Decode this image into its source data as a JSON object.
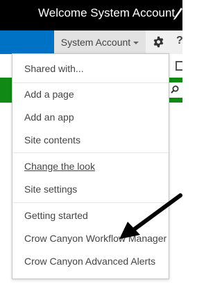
{
  "header": {
    "welcome_text": "Welcome System Account"
  },
  "suite_bar": {
    "account_label": "System Account"
  },
  "menu": {
    "items": [
      {
        "label": "Shared with..."
      },
      {
        "label": "Add a page"
      },
      {
        "label": "Add an app"
      },
      {
        "label": "Site contents"
      },
      {
        "label": "Change the look"
      },
      {
        "label": "Site settings"
      },
      {
        "label": "Getting started"
      },
      {
        "label": "Crow Canyon Workflow Manager"
      },
      {
        "label": "Crow Canyon Advanced Alerts"
      }
    ]
  },
  "icons": {
    "edit": "pencil-icon",
    "settings": "gear-icon",
    "help": "help-icon",
    "search": "search-icon",
    "focus": "focus-icon",
    "caret": "chevron-down-icon",
    "pointer": "arrow-annotation-icon"
  },
  "colors": {
    "top_bar": "#000000",
    "suite_accent": "#0072c6",
    "green_bar": "#118a15",
    "menu_text": "#444444"
  }
}
